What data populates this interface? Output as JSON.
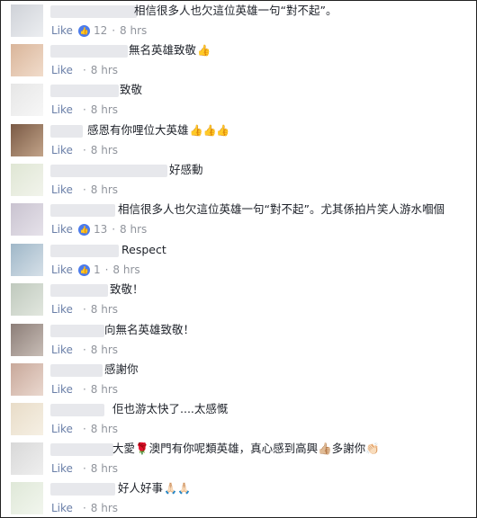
{
  "comments": [
    {
      "text": "相信很多人也欠這位英雄一句“對不起”。",
      "emoji": "",
      "like": "Like",
      "likes": "12",
      "time": "8 hrs"
    },
    {
      "text": "無名英雄致敬",
      "emoji": "👍",
      "like": "Like",
      "likes": "",
      "time": "8 hrs"
    },
    {
      "text": "致敬",
      "emoji": "",
      "like": "Like",
      "likes": "",
      "time": "8 hrs"
    },
    {
      "text": "感恩有你哩位大英雄",
      "emoji": "👍👍👍",
      "like": "Like",
      "likes": "",
      "time": "8 hrs"
    },
    {
      "text": "好感動",
      "emoji": "",
      "like": "Like",
      "likes": "",
      "time": "8 hrs"
    },
    {
      "text": "相信很多人也欠這位英雄一句“對不起”。尤其係拍片笑人游水嗰個",
      "emoji": "",
      "like": "Like",
      "likes": "13",
      "time": "8 hrs"
    },
    {
      "text": "Respect",
      "emoji": "",
      "like": "Like",
      "likes": "1",
      "time": "8 hrs"
    },
    {
      "text": "致敬！",
      "emoji": "",
      "like": "Like",
      "likes": "",
      "time": "8 hrs"
    },
    {
      "text": "向無名英雄致敬！",
      "emoji": "",
      "like": "Like",
      "likes": "",
      "time": "8 hrs"
    },
    {
      "text": "感謝你",
      "emoji": "",
      "like": "Like",
      "likes": "",
      "time": "8 hrs"
    },
    {
      "text": "佢也游太快了....太感慨",
      "emoji": "",
      "like": "Like",
      "likes": "",
      "time": "8 hrs"
    },
    {
      "text": "大愛🌹澳門有你呢類英雄，真心感到高興👍🏼多謝你👏🏻",
      "emoji": "",
      "like": "Like",
      "likes": "",
      "time": "8 hrs"
    },
    {
      "text": "好人好事",
      "emoji": "🙏🏻🙏🏻",
      "like": "Like",
      "likes": "",
      "time": "8 hrs"
    }
  ]
}
